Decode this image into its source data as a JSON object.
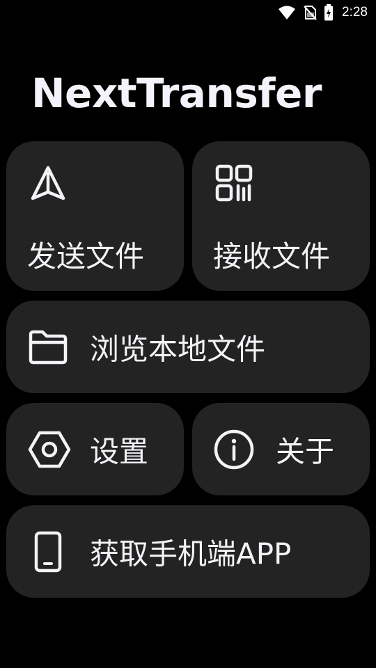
{
  "status_bar": {
    "time": "2:28",
    "icons": [
      "wifi-icon",
      "no-sim-icon",
      "battery-charging-icon"
    ]
  },
  "app": {
    "title": "NextTransfer"
  },
  "menu": {
    "send": {
      "label": "发送文件",
      "icon": "send-icon"
    },
    "receive": {
      "label": "接收文件",
      "icon": "qr-code-icon"
    },
    "browse": {
      "label": "浏览本地文件",
      "icon": "folder-icon"
    },
    "settings": {
      "label": "设置",
      "icon": "settings-hexagon-icon"
    },
    "about": {
      "label": "关于",
      "icon": "info-icon"
    },
    "get_app": {
      "label": "获取手机端APP",
      "icon": "phone-icon"
    }
  },
  "colors": {
    "background": "#000000",
    "card": "#232323",
    "text": "#f2f2f7"
  }
}
